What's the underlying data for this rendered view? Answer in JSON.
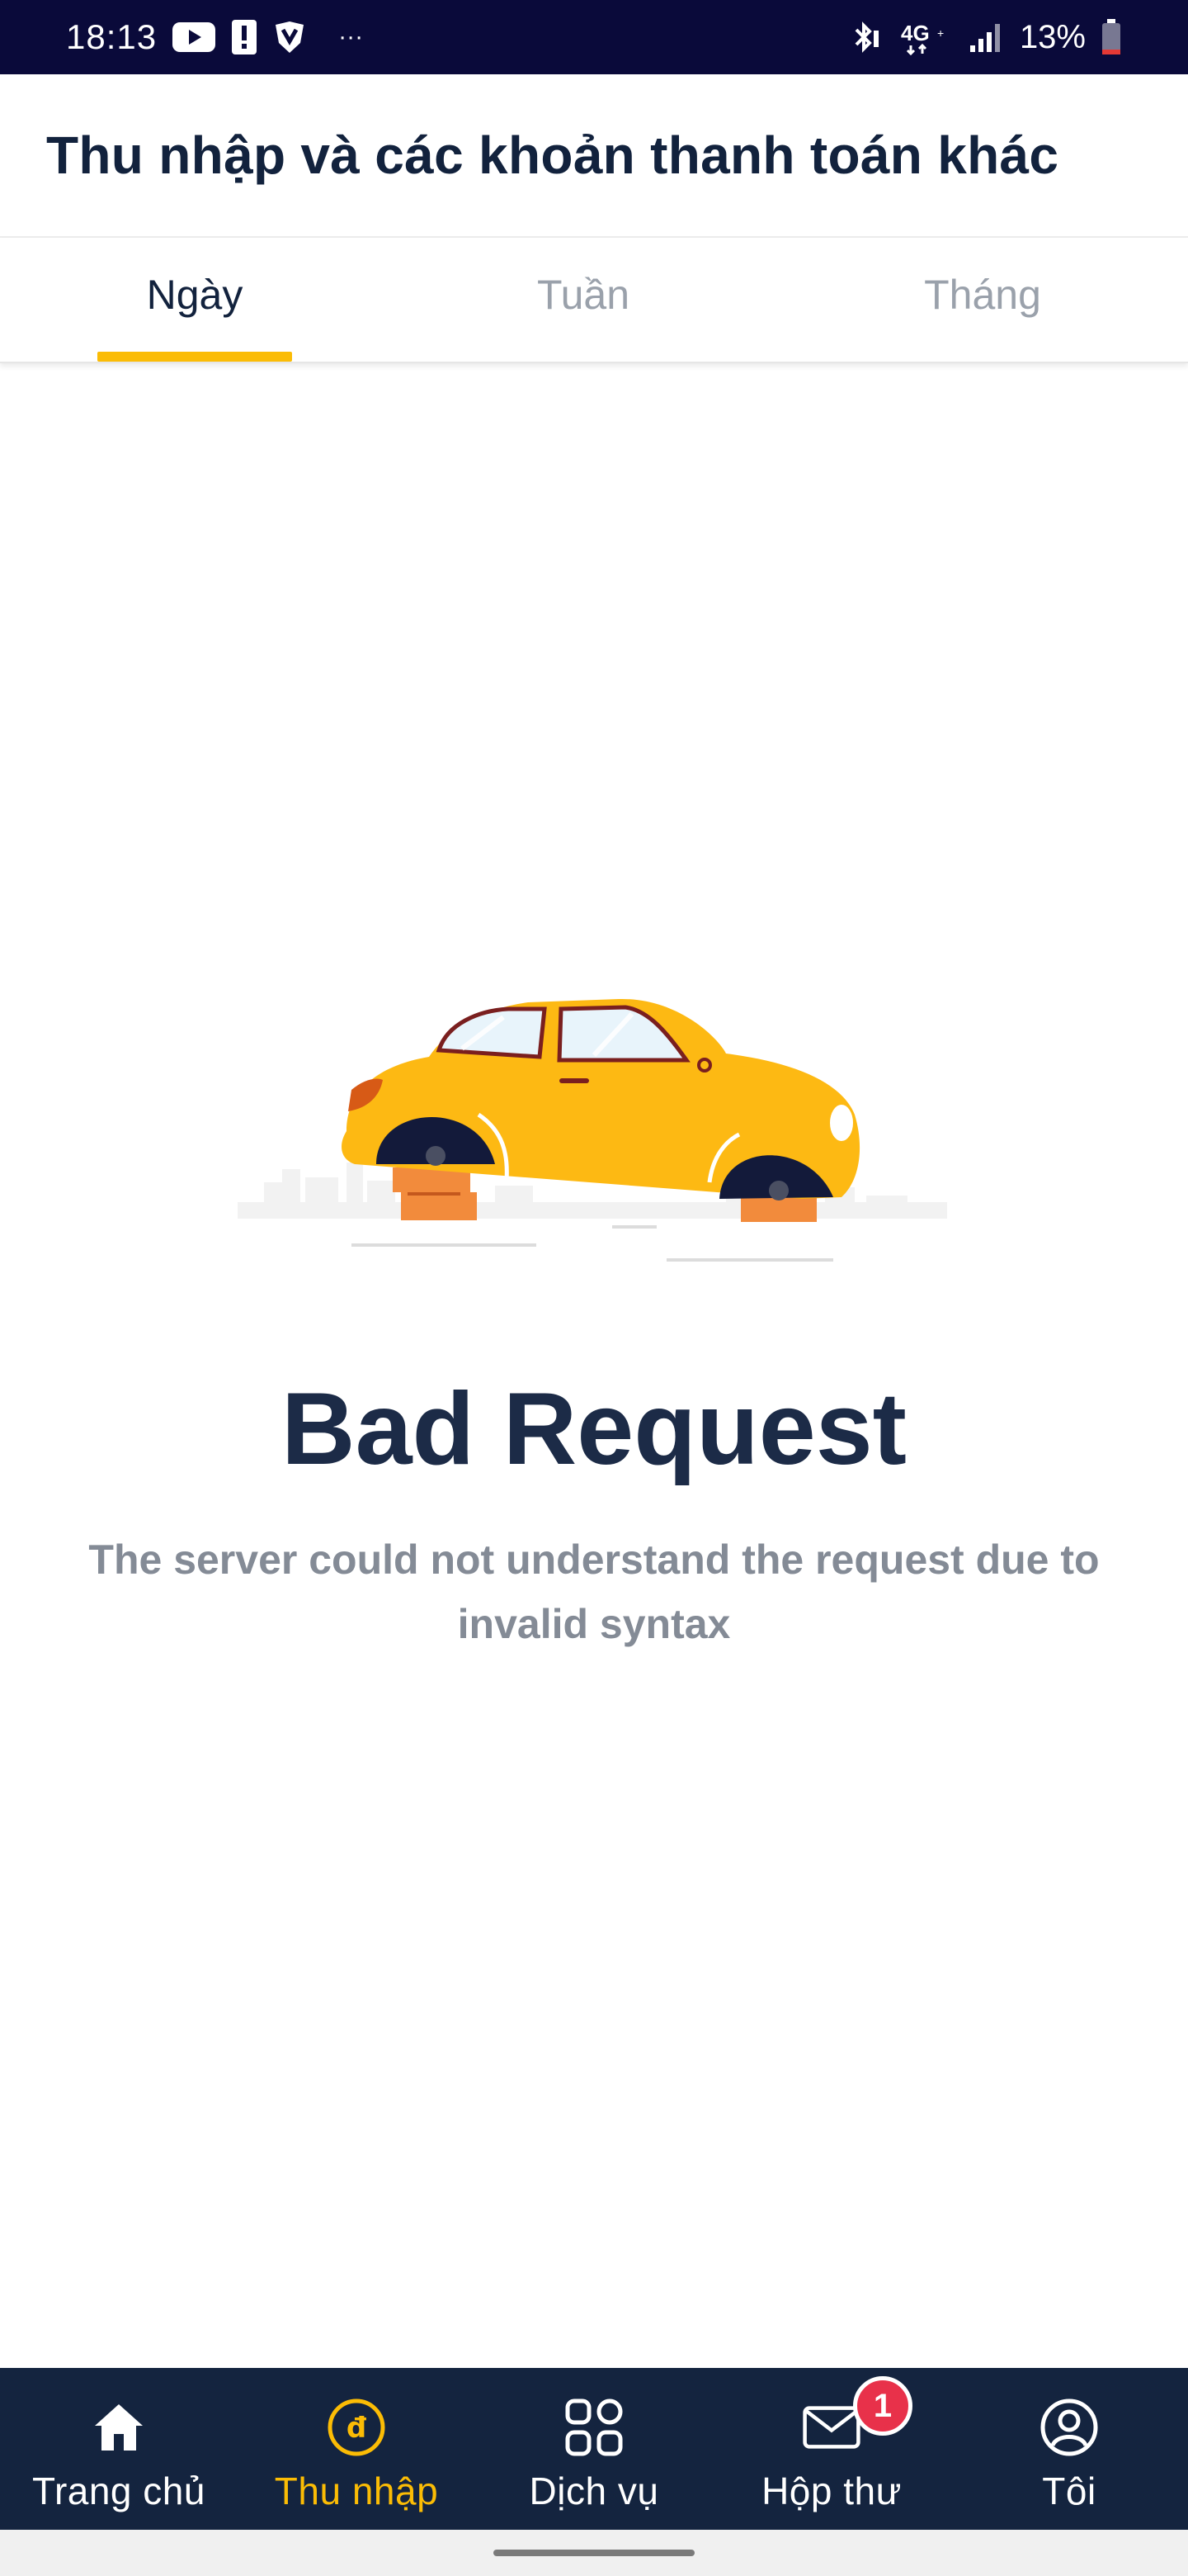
{
  "status_bar": {
    "time": "18:13",
    "network": "4G",
    "battery": "13%",
    "icons": [
      "youtube-icon",
      "alert-icon",
      "vpn-shield-icon",
      "more-dots-icon",
      "bluetooth-icon",
      "signal-icon",
      "battery-icon"
    ]
  },
  "header": {
    "title": "Thu nhập và các khoản thanh toán khác"
  },
  "tabs": [
    {
      "label": "Ngày",
      "active": true
    },
    {
      "label": "Tuần",
      "active": false
    },
    {
      "label": "Tháng",
      "active": false
    }
  ],
  "error": {
    "title": "Bad Request",
    "message": "The server could not understand the request due to invalid syntax"
  },
  "bottom_nav": {
    "items": [
      {
        "label": "Trang chủ",
        "icon": "home-icon",
        "active": false
      },
      {
        "label": "Thu nhập",
        "icon": "dong-coin-icon",
        "active": true
      },
      {
        "label": "Dịch vụ",
        "icon": "grid-icon",
        "active": false
      },
      {
        "label": "Hộp thư",
        "icon": "mail-icon",
        "active": false,
        "badge": "1"
      },
      {
        "label": "Tôi",
        "icon": "user-icon",
        "active": false
      }
    ]
  },
  "colors": {
    "accent": "#fbbc05",
    "nav_background": "#14243f",
    "status_bar": "#0a0a3a",
    "badge": "#e8314a",
    "title_text": "#1c2b47"
  }
}
